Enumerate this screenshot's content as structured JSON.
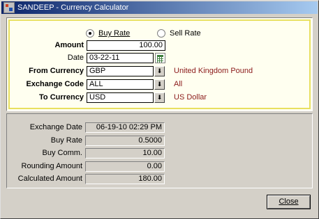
{
  "window": {
    "title": "SANDEEP - Currency Calculator"
  },
  "rate_type": {
    "buy_label": "Buy Rate",
    "sell_label": "Sell Rate",
    "selected": "buy"
  },
  "form": {
    "amount_label": "Amount",
    "amount_value": "100.00",
    "date_label": "Date",
    "date_value": "03-22-11",
    "from_label": "From Currency",
    "from_value": "GBP",
    "from_desc": "United Kingdom Pound",
    "exchange_label": "Exchange Code",
    "exchange_value": "ALL",
    "exchange_desc": "All",
    "to_label": "To Currency",
    "to_value": "USD",
    "to_desc": "US Dollar"
  },
  "results": {
    "exchange_date_label": "Exchange Date",
    "exchange_date_value": "06-19-10 02:29 PM",
    "buy_rate_label": "Buy Rate",
    "buy_rate_value": "0.5000",
    "buy_comm_label": "Buy Comm.",
    "buy_comm_value": "10.00",
    "rounding_label": "Rounding Amount",
    "rounding_value": "0.00",
    "calculated_label": "Calculated Amount",
    "calculated_value": "180.00"
  },
  "buttons": {
    "close_label": "Close"
  },
  "icons": {
    "dropdown": "arrow-down-icon",
    "calendar": "calendar-icon",
    "app": "app-icon"
  },
  "colors": {
    "description_text": "#8b1a1a",
    "highlight_border": "#e8e060",
    "title_gradient_start": "#0a246a"
  }
}
